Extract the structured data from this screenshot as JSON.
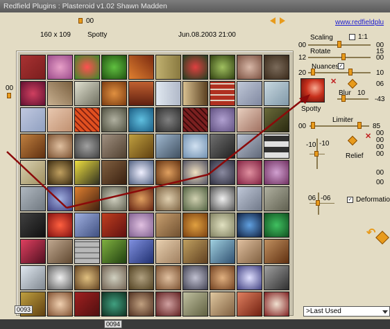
{
  "window": {
    "title": "Redfield Plugins : Plasteroid v1.02   Shawn Madden"
  },
  "header": {
    "top_counter": "00",
    "size": "160 x 109",
    "preset_name": "Spotty",
    "date": "Jun.08.2003  21:00",
    "link": "www.redfieldplu",
    "left_counter": "00"
  },
  "controls": {
    "scaling": {
      "label": "Scaling",
      "value_left": "00",
      "value_right": "00"
    },
    "ratio": {
      "label": "1:1"
    },
    "rotate": {
      "label": "Rotate",
      "value_left": "12",
      "value_right": "15",
      "value_right2": "00"
    },
    "nuances": {
      "label": "Nuances",
      "value_left": "20",
      "value_right": "10"
    },
    "thumb_label": "Spotty",
    "blur": {
      "label": "Blur",
      "value": "10",
      "side_a": "06",
      "side_b": "-43"
    },
    "limiter": {
      "label": "Limiter",
      "value_left": "00",
      "value_right": "85",
      "right_values": [
        "00",
        "00",
        "00",
        "00"
      ]
    },
    "relief": {
      "label": "Relief",
      "value_a": "-10",
      "value_b": "-10"
    },
    "extra": {
      "v1": "00",
      "v2": "00"
    },
    "deformation": {
      "label": "Deformation",
      "value_a": "06",
      "value_b": "-06"
    }
  },
  "preset_menu": {
    "selected": "Last Used"
  },
  "status": {
    "left": "0093",
    "bottom": "0094"
  },
  "colors": {
    "accent": "#e89b1c",
    "bg": "#e3dcc4",
    "arrow": "#8b0a0a"
  },
  "tiles": [
    "linear-gradient(135deg,#a83232,#7a1e1e)",
    "radial-gradient(#e8a0c8,#9a4a8a)",
    "radial-gradient(#ff5050,#3a8a2a)",
    "radial-gradient(#60c040,#205010)",
    "linear-gradient(45deg,#e08030,#7a2a10)",
    "linear-gradient(90deg,#c0b070,#8a7a40)",
    "radial-gradient(#e04040,#204020)",
    "radial-gradient(#a0c060,#304010)",
    "radial-gradient(#d8b8a8,#7a5040)",
    "radial-gradient(#7a6a5a,#3a2a1a)",
    "radial-gradient(#d04060,#601030)",
    "linear-gradient(45deg,#c8b090,#7a6040)",
    "linear-gradient(135deg,#e0e0d0,#707060)",
    "radial-gradient(#e09040,#7a3a10)",
    "linear-gradient(#c06030,#602010)",
    "linear-gradient(90deg,#e0e8f0,#b0b8c8)",
    "linear-gradient(90deg,#d8c090,#5a4020)",
    "repeating-linear-gradient(0deg,#b03020 0 6px,#e0d0c0 6px 8px)",
    "linear-gradient(135deg,#c0c8d8,#8088a0)",
    "linear-gradient(135deg,#c8d8e0,#8098a8)",
    "linear-gradient(135deg,#c0c8e0,#90a0c0)",
    "linear-gradient(135deg,#e8c8b0,#c09070)",
    "repeating-linear-gradient(45deg,#e05020 0 4px,#802010 4px 6px)",
    "radial-gradient(#b0b0a0,#505040)",
    "radial-gradient(#60c0e0,#1a5a80)",
    "radial-gradient(#808080,#303030)",
    "repeating-linear-gradient(45deg,#7a2020 0 4px,#3a0a0a 4px 6px)",
    "radial-gradient(#b0a0d0,#605080)",
    "linear-gradient(135deg,#e8d0c0,#a07060)",
    "linear-gradient(135deg,#6a6a3a,#2a2a10)",
    "linear-gradient(135deg,#c08040,#603010)",
    "radial-gradient(#e0c0a0,#7a5030)",
    "radial-gradient(#a0a0a0,#404040)",
    "linear-gradient(135deg,#a09080,#504030)",
    "linear-gradient(135deg,#c0a040,#604010)",
    "linear-gradient(135deg,#a0b8d0,#405060)",
    "radial-gradient(#d0e0f0,#7090b0)",
    "linear-gradient(135deg,#707070,#202020)",
    "linear-gradient(135deg,#b8c0d0,#606878)",
    "repeating-linear-gradient(0deg,#e0e0e0 0 8px,#303030 8px 16px)",
    "linear-gradient(135deg,#d8d0b0,#a09060)",
    "radial-gradient(#c0a060,#3a2a10)",
    "linear-gradient(135deg,#f0e040,#303020)",
    "linear-gradient(135deg,#806040,#3a2010)",
    "radial-gradient(#f0f0ff,#506080)",
    "radial-gradient(#e0a060,#603010)",
    "radial-gradient(#f0e0c0,#505060)",
    "radial-gradient(#8a8aa0,#303040)",
    "radial-gradient(#e090a0,#802040)",
    "radial-gradient(#d0a0d0,#703060)",
    "linear-gradient(135deg,#b0b8c0,#707880)",
    "radial-gradient(#a0b0e0,#404080)",
    "linear-gradient(135deg,#e08030,#402010)",
    "radial-gradient(#d0d0c0,#606050)",
    "radial-gradient(#e0a060,#602010)",
    "radial-gradient(#e0d0b0,#7a6040)",
    "radial-gradient(#d0d0b0,#506040)",
    "radial-gradient(#f0f0f0,#505050)",
    "linear-gradient(135deg,#c0c8d8,#707888)",
    "linear-gradient(135deg,#b0b0a0,#606050)",
    "linear-gradient(135deg,#404040,#101010)",
    "radial-gradient(#ff6040,#801010)",
    "linear-gradient(135deg,#a0b0e0,#405080)",
    "linear-gradient(135deg,#c04020,#601010)",
    "radial-gradient(#e0c0e0,#806090)",
    "linear-gradient(135deg,#c8a070,#705030)",
    "radial-gradient(#e0a040,#7a4010)",
    "radial-gradient(#e0e0c0,#808060)",
    "radial-gradient(#60a0e0,#102040)",
    "radial-gradient(#40c060,#105020)",
    "linear-gradient(135deg,#e04060,#501020)",
    "linear-gradient(135deg,#c0a890,#604830)",
    "repeating-linear-gradient(0deg,#b8b8b8 0 6px,#808080 6px 8px)",
    "linear-gradient(135deg,#80b040,#204010)",
    "linear-gradient(135deg,#8090e0,#203070)",
    "linear-gradient(135deg,#e8d0b0,#a08060)",
    "linear-gradient(135deg,#c0a060,#604020)",
    "linear-gradient(135deg,#a0d0e0,#305070)",
    "linear-gradient(135deg,#e0c0a0,#806040)",
    "linear-gradient(135deg,#c09060,#603010)",
    "linear-gradient(135deg,#e0e8f0,#808890)",
    "radial-gradient(#f0f0f0,#606060)",
    "radial-gradient(#e0c080,#604020)",
    "radial-gradient(#d0d0c0,#706050)",
    "radial-gradient(#b0a080,#504020)",
    "radial-gradient(#e0c0a0,#7a5030)",
    "radial-gradient(#c0c0d0,#404050)",
    "radial-gradient(#e0b080,#704020)",
    "radial-gradient(#e0e0ff,#404080)",
    "linear-gradient(135deg,#a0a0a0,#303030)",
    "linear-gradient(135deg,#c0a040,#604010)",
    "radial-gradient(#f0d0b0,#805030)",
    "linear-gradient(135deg,#a02020,#501010)",
    "radial-gradient(#40a080,#103020)",
    "radial-gradient(#c0a080,#503020)",
    "radial-gradient(#d0a0a0,#602020)",
    "linear-gradient(135deg,#c0c0a0,#606040)",
    "linear-gradient(135deg,#e0c8a0,#806040)",
    "linear-gradient(135deg,#e08060,#702010)",
    "radial-gradient(#f0e0d0,#802020)"
  ]
}
